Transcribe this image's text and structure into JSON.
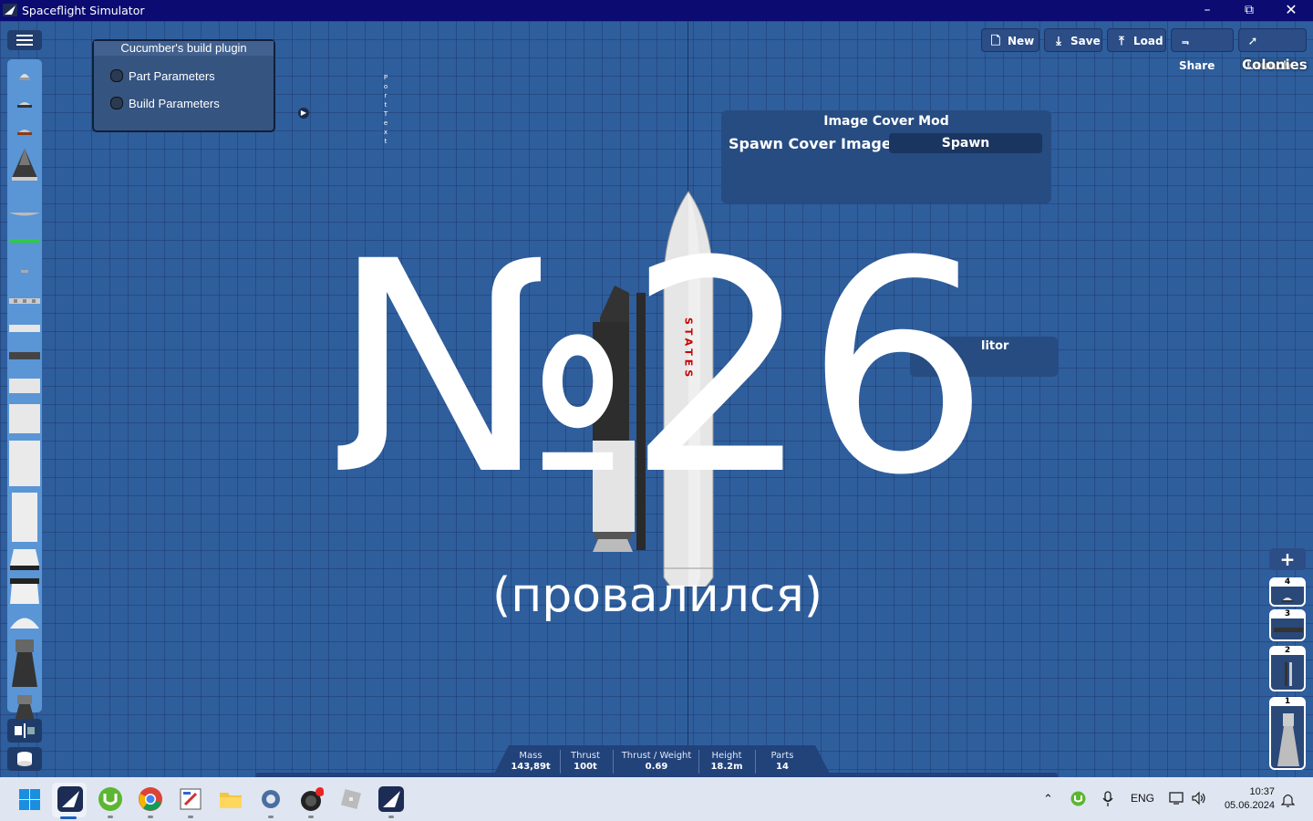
{
  "window": {
    "title": "Spaceflight Simulator"
  },
  "plugin": {
    "title": "Cucumber's build plugin",
    "items": [
      "Part Parameters",
      "Build Parameters"
    ]
  },
  "vertical_text": "P o r t T e x t",
  "toolbar": {
    "new": "New",
    "save": "Save",
    "load": "Load",
    "share": "Share",
    "launch": "Launch",
    "colonies": "Colonies"
  },
  "image_cover_mod": {
    "title": "Image Cover Mod",
    "label": "Spawn Cover Image",
    "button": "Spawn"
  },
  "editor_panel": {
    "partial_title": "litor"
  },
  "overlay": {
    "big": "№26",
    "sub": "(провалился)"
  },
  "rocket": {
    "label": "STATES"
  },
  "stages": {
    "add": "+",
    "items": [
      "4",
      "3",
      "2",
      "1"
    ]
  },
  "stats": {
    "mass_label": "Mass",
    "mass": "143,89t",
    "thrust_label": "Thrust",
    "thrust": "100t",
    "tw_label": "Thrust / Weight",
    "tw": "0.69",
    "height_label": "Height",
    "height": "18.2m",
    "parts_label": "Parts",
    "parts": "14"
  },
  "taskbar": {
    "lang": "ENG",
    "time": "10:37",
    "date": "05.06.2024"
  }
}
